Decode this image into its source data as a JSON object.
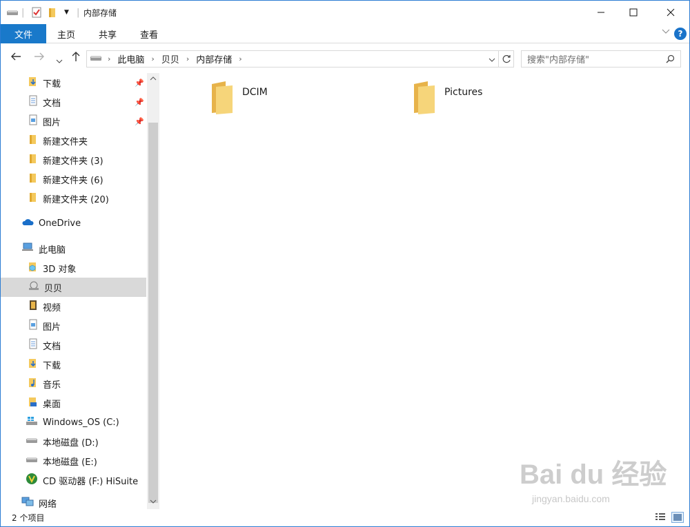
{
  "window": {
    "title": "内部存储"
  },
  "ribbon": {
    "tabs": [
      {
        "label": "文件"
      },
      {
        "label": "主页"
      },
      {
        "label": "共享"
      },
      {
        "label": "查看"
      }
    ],
    "help_label": "?"
  },
  "address": {
    "crumbs": [
      "此电脑",
      "贝贝",
      "内部存储"
    ]
  },
  "search": {
    "placeholder": "搜索\"内部存储\""
  },
  "nav": {
    "quick_access": [
      {
        "label": "下载",
        "icon": "download-folder-icon",
        "pinned": true
      },
      {
        "label": "文档",
        "icon": "documents-icon",
        "pinned": true
      },
      {
        "label": "图片",
        "icon": "pictures-icon",
        "pinned": true
      },
      {
        "label": "新建文件夹",
        "icon": "folder-icon"
      },
      {
        "label": "新建文件夹 (3)",
        "icon": "folder-icon"
      },
      {
        "label": "新建文件夹 (6)",
        "icon": "folder-icon"
      },
      {
        "label": "新建文件夹 (20)",
        "icon": "folder-icon"
      }
    ],
    "onedrive": {
      "label": "OneDrive",
      "icon": "onedrive-cloud-icon"
    },
    "this_pc": {
      "label": "此电脑",
      "icon": "computer-icon"
    },
    "pc_items": [
      {
        "label": "3D 对象",
        "icon": "3d-objects-icon"
      },
      {
        "label": "贝贝",
        "icon": "phone-device-icon",
        "selected": true
      },
      {
        "label": "视频",
        "icon": "videos-icon"
      },
      {
        "label": "图片",
        "icon": "pictures-icon"
      },
      {
        "label": "文档",
        "icon": "documents-icon"
      },
      {
        "label": "下载",
        "icon": "download-folder-icon"
      },
      {
        "label": "音乐",
        "icon": "music-icon"
      },
      {
        "label": "桌面",
        "icon": "desktop-icon"
      },
      {
        "label": "Windows_OS (C:)",
        "icon": "windows-drive-icon"
      },
      {
        "label": "本地磁盘 (D:)",
        "icon": "drive-icon"
      },
      {
        "label": "本地磁盘 (E:)",
        "icon": "drive-icon"
      },
      {
        "label": "CD 驱动器 (F:) HiSuite",
        "icon": "cd-drive-icon"
      }
    ],
    "network": {
      "label": "网络",
      "icon": "network-icon"
    }
  },
  "content": {
    "items": [
      {
        "name": "DCIM",
        "icon": "folder-icon"
      },
      {
        "name": "Pictures",
        "icon": "folder-icon"
      }
    ]
  },
  "status": {
    "count_text": "2 个项目"
  },
  "watermark": {
    "brand": "Bai du 经验",
    "url": "jingyan.baidu.com"
  },
  "colors": {
    "accent": "#1979ca",
    "selected_bg": "#d9d9d9",
    "folder": "#f4c95d"
  }
}
